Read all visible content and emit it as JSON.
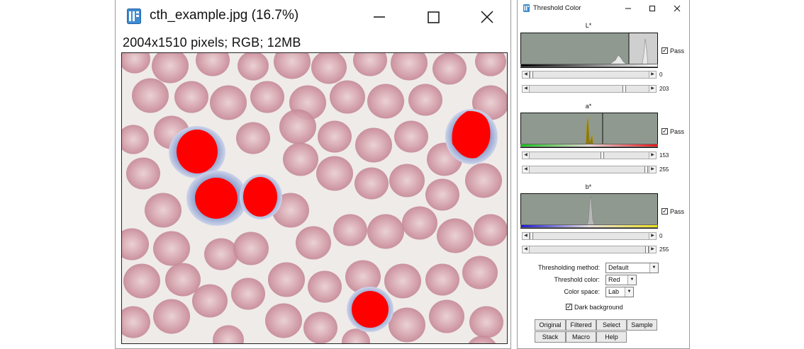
{
  "image_window": {
    "title": "cth_example.jpg (16.7%)",
    "info": "2004x1510 pixels; RGB; 12MB",
    "controls": {
      "minimize": "—",
      "maximize": "☐",
      "close": "✕"
    }
  },
  "dialog": {
    "title": "Threshold Color",
    "channels": [
      {
        "label": "L*",
        "pass_label": "Pass",
        "pass_checked": true,
        "min": "0",
        "max": "203",
        "min_fraction": 0.0,
        "max_fraction": 0.8
      },
      {
        "label": "a*",
        "pass_label": "Pass",
        "pass_checked": true,
        "min": "153",
        "max": "255",
        "min_fraction": 0.6,
        "max_fraction": 1.0
      },
      {
        "label": "b*",
        "pass_label": "Pass",
        "pass_checked": true,
        "min": "0",
        "max": "255",
        "min_fraction": 0.0,
        "max_fraction": 1.0
      }
    ],
    "thresholding_method": {
      "label": "Thresholding method:",
      "value": "Default"
    },
    "threshold_color": {
      "label": "Threshold color:",
      "value": "Red"
    },
    "color_space": {
      "label": "Color space:",
      "value": "Lab"
    },
    "dark_background": {
      "label": "Dark background",
      "checked": true
    },
    "buttons": {
      "original": "Original",
      "filtered": "Filtered",
      "select": "Select",
      "sample": "Sample",
      "stack": "Stack",
      "macro": "Macro",
      "help": "Help"
    }
  },
  "colors": {
    "threshold_red": "#ff0000",
    "rbc_pink": "#d49ca7",
    "histogram_gray": "#8f9990",
    "histogram_background": "#cfcfcf"
  }
}
